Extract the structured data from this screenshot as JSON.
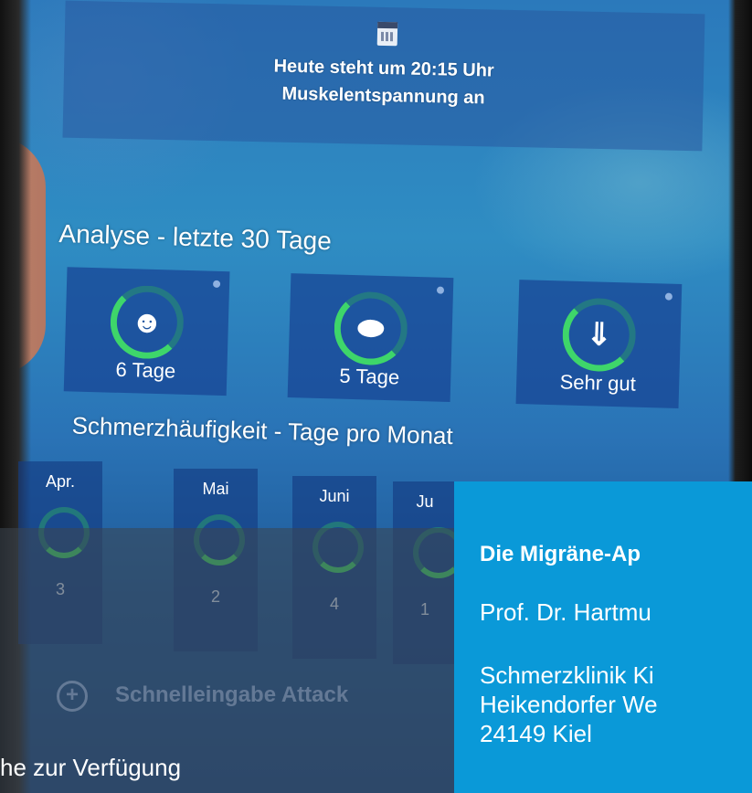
{
  "reminder": {
    "icon": "calendar-icon",
    "line1": "Heute steht um 20:15 Uhr",
    "line2": "Muskelentspannung an"
  },
  "analysis": {
    "title": "Analyse - letzte 30 Tage",
    "tiles": [
      {
        "icon": "head-icon",
        "label": "6 Tage"
      },
      {
        "icon": "pill-icon",
        "label": "5 Tage"
      },
      {
        "icon": "effect-arrow-icon",
        "label": "Sehr gut"
      }
    ]
  },
  "frequency": {
    "title": "Schmerzhäufigkeit - Tage pro Monat",
    "months": [
      {
        "name": "Apr.",
        "value": "3"
      },
      {
        "name": "Mai",
        "value": "2"
      },
      {
        "name": "Juni",
        "value": "4"
      },
      {
        "name": "Ju",
        "value": "1"
      }
    ]
  },
  "quick_entry": {
    "label": "Schnelleingabe Attack",
    "icon": "plus-circle-icon"
  },
  "caption": "he zur Verfügung",
  "info": {
    "title": "Die Migräne-Ap",
    "author": "Prof. Dr. Hartmu",
    "address_lines": [
      "Schmerzklinik Ki",
      "Heikendorfer We",
      "24149 Kiel"
    ]
  },
  "colors": {
    "panel_blue": "#0a99d8",
    "ring_green": "#3ed66a"
  }
}
